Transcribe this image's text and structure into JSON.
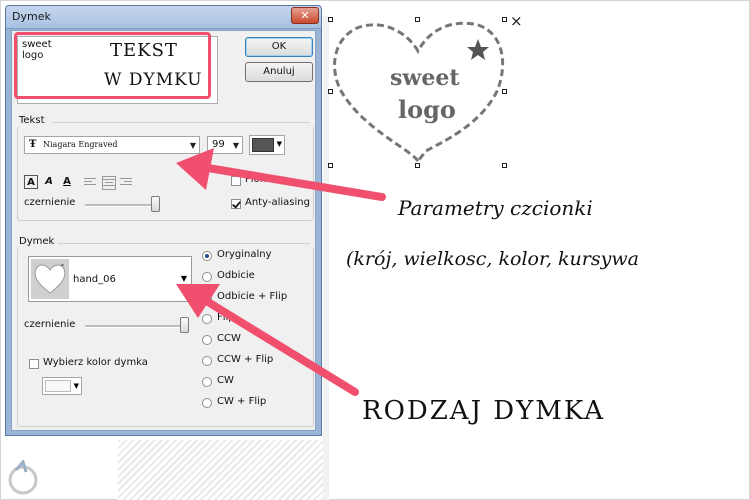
{
  "dialog": {
    "title": "Dymek",
    "close_label": "✕",
    "text_value": "sweet\nlogo",
    "ok_label": "OK",
    "cancel_label": "Anuluj"
  },
  "text_section": {
    "label": "Tekst",
    "font_name": "Niagara Engraved",
    "font_size": "99",
    "format_buttons": [
      "A",
      "A",
      "A"
    ],
    "vertical_label": "Pionowo",
    "vertical_checked": false,
    "antialias_label": "Anty-aliasing",
    "antialias_checked": true,
    "darken_label": "czernienie",
    "darken_level": 0.95,
    "text_color": "#555555"
  },
  "bubble_section": {
    "label": "Dymek",
    "shape_name": "hand_06",
    "darken_label": "czernienie",
    "darken_level": 1.0,
    "choose_color_label": "Wybierz kolor dymka",
    "choose_color_checked": false,
    "orientation_options": [
      "Oryginalny",
      "Odbicie",
      "Odbicie + Flip",
      "Flip",
      "CCW",
      "CCW + Flip",
      "CW",
      "CW + Flip"
    ],
    "orientation_selected": 0
  },
  "preview": {
    "line1": "sweet",
    "line2": "logo",
    "close_mark": "×"
  },
  "annotations": {
    "dialog_textarea_note_line1": "TEKST",
    "dialog_textarea_note_line2": "W DYMKU",
    "font_note_line1": "Parametry czcionki",
    "font_note_line2": "(krój, wielkosc, kolor, kursywa",
    "shape_note": "RODZAJ DYMKA",
    "accent_color": "#f0506e"
  }
}
